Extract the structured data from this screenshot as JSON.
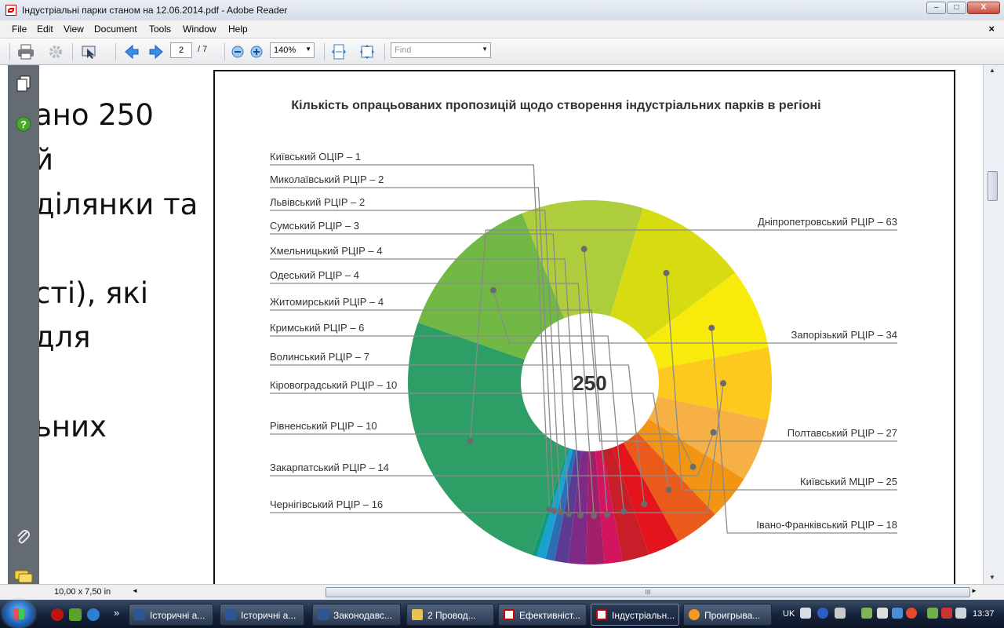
{
  "window": {
    "title": "Індустріальні парки станом на 12.06.2014.pdf - Adobe Reader",
    "controls": {
      "minimize": "–",
      "maximize": "□",
      "close": "X"
    }
  },
  "menu": {
    "items": [
      "File",
      "Edit",
      "View",
      "Document",
      "Tools",
      "Window",
      "Help"
    ],
    "close_doc": "×"
  },
  "toolbar": {
    "page_current": "2",
    "page_total": "/ 7",
    "zoom": "140%",
    "find_placeholder": "Find",
    "icons": [
      "print-icon",
      "settings-icon",
      "select-tool-icon",
      "prev-page-icon",
      "next-page-icon",
      "zoom-out-icon",
      "zoom-in-icon",
      "fit-width-icon",
      "fit-page-icon"
    ]
  },
  "side_panel": {
    "icons": [
      "pages-icon",
      "help-icon",
      "attachments-icon",
      "comments-icon"
    ]
  },
  "document": {
    "text_fragments": [
      "ано 250",
      "й",
      "ділянки та",
      "сті), які",
      "для",
      "ьних"
    ]
  },
  "chart_data": {
    "type": "pie",
    "title": "Кількість опрацьованих пропозицій щодо створення індустріальних парків в регіоні",
    "center_label": "250",
    "total": 250,
    "slices": [
      {
        "label": "Дніпропетровський РЦІР – 63",
        "value": 63,
        "color": "#2e9e67"
      },
      {
        "label": "Запорізький РЦІР – 34",
        "value": 34,
        "color": "#72b844"
      },
      {
        "label": "Полтавський РЦІР – 27",
        "value": 27,
        "color": "#aecd3d"
      },
      {
        "label": "Київський МЦІР – 25",
        "value": 25,
        "color": "#d6db12"
      },
      {
        "label": "Івано-Франківський РЦІР – 18",
        "value": 18,
        "color": "#f8ea0a"
      },
      {
        "label": "Чернігівський РЦІР – 16",
        "value": 16,
        "color": "#fdc91f"
      },
      {
        "label": "Закарпатський РЦІР – 14",
        "value": 14,
        "color": "#f7b043"
      },
      {
        "label": "Рівненський РЦІР – 10",
        "value": 10,
        "color": "#f29514"
      },
      {
        "label": "Кіровоградський РЦІР – 10",
        "value": 10,
        "color": "#ea5a1a"
      },
      {
        "label": "Волинський РЦІР – 7",
        "value": 7,
        "color": "#e3141b"
      },
      {
        "label": "Кримський РЦІР – 6",
        "value": 6,
        "color": "#c81e2a"
      },
      {
        "label": "Житомирський РЦІР – 4",
        "value": 4,
        "color": "#d3145e"
      },
      {
        "label": "Одеський РЦІР – 4",
        "value": 4,
        "color": "#a2206a"
      },
      {
        "label": "Хмельницький РЦІР – 4",
        "value": 4,
        "color": "#7d2b86"
      },
      {
        "label": "Сумський РЦІР – 3",
        "value": 3,
        "color": "#5b3c94"
      },
      {
        "label": "Львівський РЦІР – 2",
        "value": 2,
        "color": "#2b6eb5"
      },
      {
        "label": "Миколаївський РЦІР – 2",
        "value": 2,
        "color": "#1ba1cf"
      },
      {
        "label": "Київський ОЦІР – 1",
        "value": 1,
        "color": "#0f9b79"
      }
    ]
  },
  "statusbar": {
    "page_size": "10,00 x 7,50 in",
    "scroll_grip": "III"
  },
  "taskbar": {
    "tasks": [
      {
        "label": "Історичні а..."
      },
      {
        "label": "Історичні а..."
      },
      {
        "label": "Законодавс..."
      },
      {
        "label": "2 Провод..."
      },
      {
        "label": "Ефективніст..."
      },
      {
        "label": "Індустріальн..."
      },
      {
        "label": "Проигрыва..."
      }
    ],
    "lang": "UK",
    "clock": "13:37",
    "show_more": "»"
  }
}
